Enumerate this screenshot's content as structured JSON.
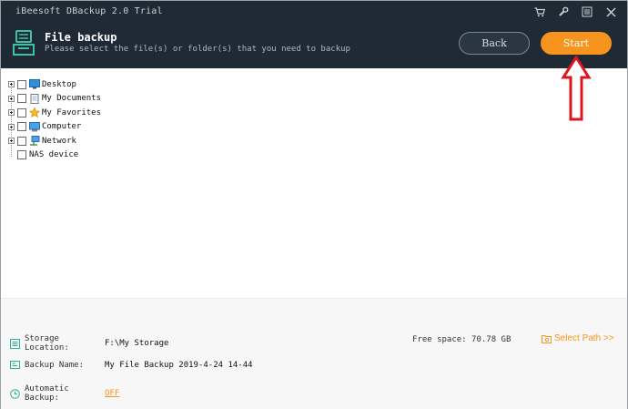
{
  "app": {
    "title": "iBeesoft DBackup 2.0 Trial"
  },
  "window_controls": [
    {
      "name": "cart-icon"
    },
    {
      "name": "wrench-icon"
    },
    {
      "name": "menu-icon"
    },
    {
      "name": "close-icon"
    }
  ],
  "header": {
    "title": "File backup",
    "subtitle": "Please select the file(s) or folder(s) that you need to backup",
    "back_label": "Back",
    "start_label": "Start"
  },
  "tree": {
    "items": [
      {
        "label": "Desktop",
        "icon": "desktop-icon",
        "expandable": true
      },
      {
        "label": "My Documents",
        "icon": "documents-icon",
        "expandable": true
      },
      {
        "label": "My Favorites",
        "icon": "star-icon",
        "expandable": true
      },
      {
        "label": "Computer",
        "icon": "computer-icon",
        "expandable": true
      },
      {
        "label": "Network",
        "icon": "network-icon",
        "expandable": true
      },
      {
        "label": "NAS device",
        "icon": "",
        "expandable": false
      }
    ]
  },
  "footer": {
    "storage_label": "Storage Location:",
    "storage_value": "F:\\My Storage",
    "free_space": "Free space: 70.78 GB",
    "select_path": "Select Path >>",
    "backup_name_label": "Backup Name:",
    "backup_name_value": "My File Backup 2019-4-24 14-44",
    "auto_backup_label": "Automatic Backup:",
    "auto_backup_value": "OFF"
  },
  "colors": {
    "header_bg": "#1f2a35",
    "accent": "#f7941d",
    "arrow": "#e0141c"
  }
}
